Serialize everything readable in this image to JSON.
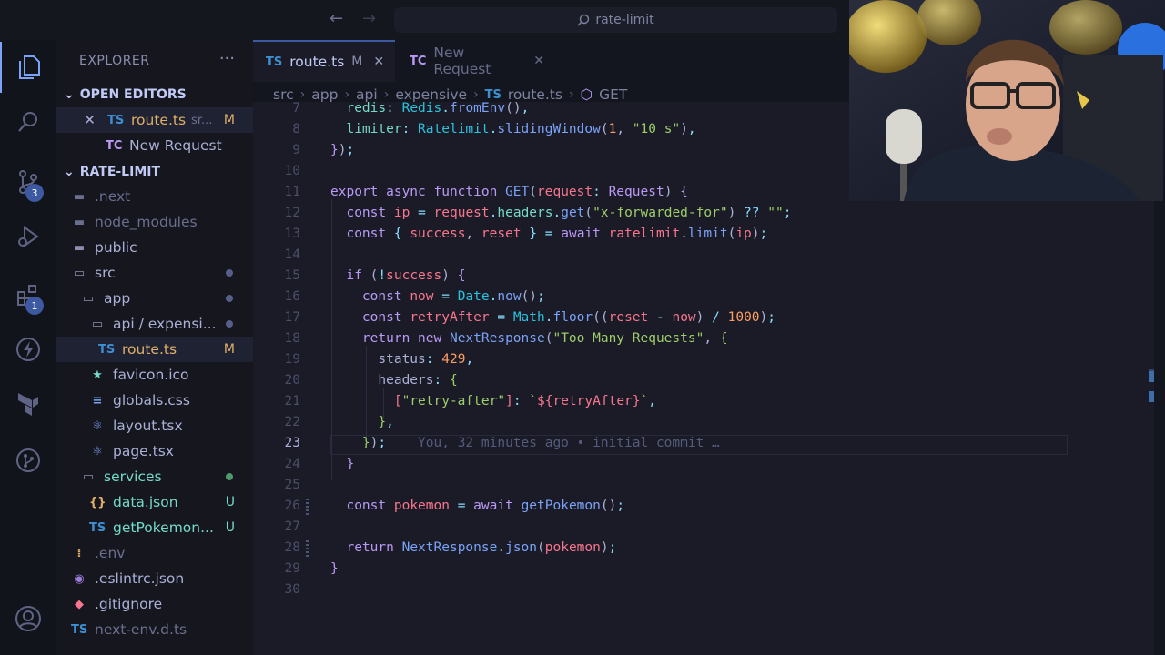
{
  "titlebar": {
    "back_icon": "arrow-left-icon",
    "forward_icon": "arrow-right-icon",
    "search_text": "rate-limit"
  },
  "activity": {
    "items": [
      "explorer-icon",
      "search-icon",
      "source-control-icon",
      "run-debug-icon",
      "extensions-icon",
      "thunder-client-icon",
      "terraform-icon",
      "git-graph-icon",
      "account-icon"
    ],
    "scm_badge": "3",
    "ext_badge": "1"
  },
  "sidebar": {
    "title": "EXPLORER",
    "more": "···",
    "open_editors_label": "OPEN EDITORS",
    "open_editors": [
      {
        "icon": "TS",
        "name": "route.ts",
        "hint": "sr...",
        "status": "M"
      },
      {
        "icon": "TC",
        "name": "New Request",
        "hint": "",
        "status": ""
      }
    ],
    "project_label": "RATE-LIMIT",
    "tree": [
      {
        "name": ".next",
        "kind": "folder"
      },
      {
        "name": "node_modules",
        "kind": "folder"
      },
      {
        "name": "public",
        "kind": "folder"
      },
      {
        "name": "src",
        "kind": "folder-open"
      },
      {
        "name": "app",
        "kind": "folder-open"
      },
      {
        "name": "api / expensi...",
        "kind": "folder-open"
      },
      {
        "name": "route.ts",
        "kind": "ts",
        "status": "M"
      },
      {
        "name": "favicon.ico",
        "kind": "ico"
      },
      {
        "name": "globals.css",
        "kind": "css"
      },
      {
        "name": "layout.tsx",
        "kind": "tsx"
      },
      {
        "name": "page.tsx",
        "kind": "tsx"
      },
      {
        "name": "services",
        "kind": "folder-open"
      },
      {
        "name": "data.json",
        "kind": "json",
        "status": "U"
      },
      {
        "name": "getPokemon...",
        "kind": "ts",
        "status": "U"
      },
      {
        "name": ".env",
        "kind": "env"
      },
      {
        "name": ".eslintrc.json",
        "kind": "eslint"
      },
      {
        "name": ".gitignore",
        "kind": "git"
      },
      {
        "name": "next-env.d.ts",
        "kind": "ts"
      }
    ]
  },
  "tabs": [
    {
      "icon": "TS",
      "label": "route.ts",
      "status": "M",
      "close": "✕"
    },
    {
      "icon": "TC",
      "label": "New Request",
      "status": "",
      "close": "✕"
    }
  ],
  "breadcrumb": {
    "parts": [
      "src",
      "app",
      "api",
      "expensive",
      "route.ts",
      "GET"
    ]
  },
  "editor": {
    "line_numbers": [
      "7",
      "8",
      "9",
      "10",
      "11",
      "12",
      "13",
      "14",
      "15",
      "16",
      "17",
      "18",
      "19",
      "20",
      "21",
      "22",
      "23",
      "24",
      "25",
      "26",
      "27",
      "28",
      "29",
      "30"
    ],
    "current_line": "23",
    "blame": "You, 32 minutes ago • initial commit …",
    "code_lines": [
      "  redis: Redis.fromEnv(),",
      "  limiter: Ratelimit.slidingWindow(1, \"10 s\"),",
      "});",
      "",
      "export async function GET(request: Request) {",
      "  const ip = request.headers.get(\"x-forwarded-for\") ?? \"\";",
      "  const { success, reset } = await ratelimit.limit(ip);",
      "",
      "  if (!success) {",
      "    const now = Date.now();",
      "    const retryAfter = Math.floor((reset - now) / 1000);",
      "    return new NextResponse(\"Too Many Requests\", {",
      "      status: 429,",
      "      headers: {",
      "        [\"retry-after\"]: `${retryAfter}`,",
      "      },",
      "    });",
      "  }",
      "",
      "  const pokemon = await getPokemon();",
      "",
      "  return NextResponse.json(pokemon);",
      "}",
      ""
    ]
  },
  "colors": {
    "accent": "#3d59a1",
    "keyword": "#bb9af7",
    "function": "#7aa2f7",
    "string": "#9ece6a",
    "number": "#ff9e64",
    "modified": "#e0af68",
    "untracked": "#73daca"
  }
}
